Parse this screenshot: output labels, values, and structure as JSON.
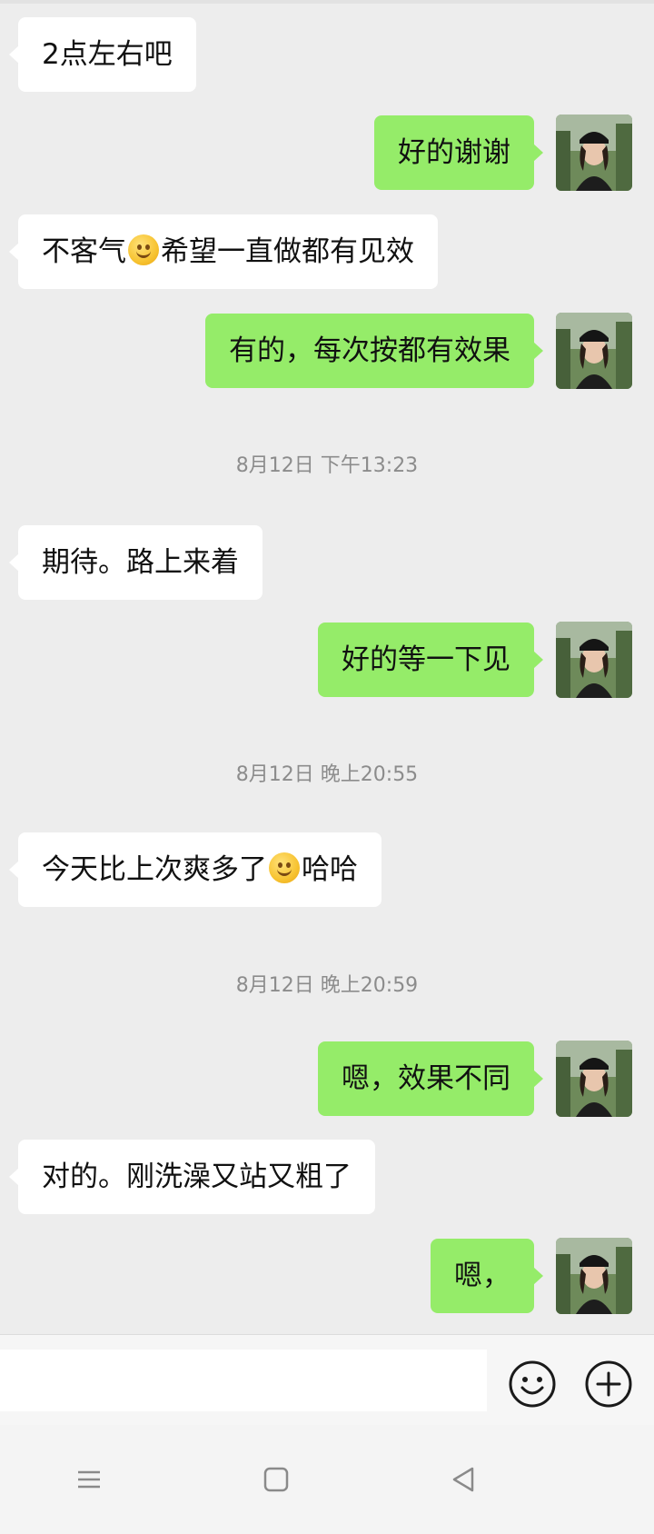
{
  "messages": [
    {
      "side": "left",
      "text": "2点左右吧"
    },
    {
      "side": "right",
      "text": "好的谢谢"
    },
    {
      "side": "left",
      "text_before": "不客气",
      "emoji": "smile-emoji",
      "text_after": "希望一直做都有见效"
    },
    {
      "side": "right",
      "text": "有的，每次按都有效果"
    },
    {
      "timestamp": "8月12日 下午13:23"
    },
    {
      "side": "left",
      "text": "期待。路上来着"
    },
    {
      "side": "right",
      "text": "好的等一下见"
    },
    {
      "timestamp": "8月12日 晚上20:55"
    },
    {
      "side": "left",
      "text_before": "今天比上次爽多了",
      "emoji": "grin-emoji",
      "text_after": "哈哈"
    },
    {
      "timestamp": "8月12日 晚上20:59"
    },
    {
      "side": "right",
      "text": "嗯，效果不同"
    },
    {
      "side": "left",
      "text": "对的。刚洗澡又站又粗了"
    },
    {
      "side": "right",
      "text": "嗯，"
    }
  ],
  "colors": {
    "sent_bubble": "#95ec69",
    "received_bubble": "#ffffff",
    "chat_bg": "#ededed"
  },
  "icons": {
    "emoji_button": "smiley-icon",
    "plus_button": "plus-circle-icon",
    "nav_menu": "menu-icon",
    "nav_home": "square-icon",
    "nav_back": "back-triangle-icon"
  }
}
